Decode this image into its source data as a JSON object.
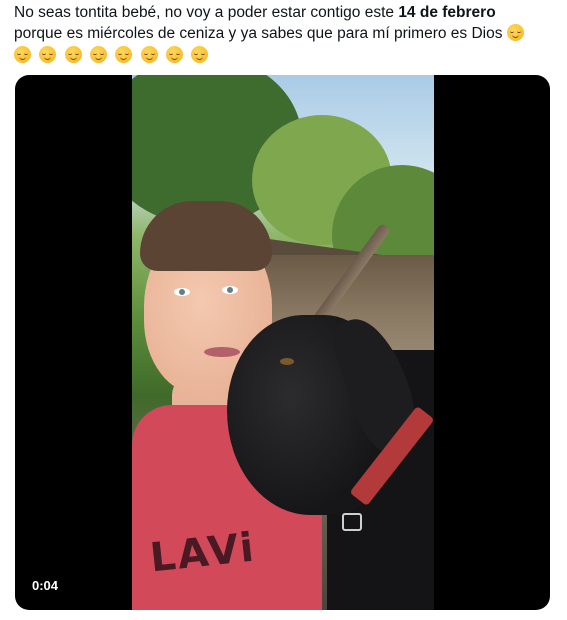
{
  "tweet": {
    "text_part1": "No seas tontita bebé, no voy a poder estar contigo este ",
    "text_bold": "14 de febrero",
    "text_part2": "porque es miércoles de ceniza y ya sabes que para mí primero es Dios",
    "emoji_name": "relieved-face-emoji",
    "emoji_count_line1": 1,
    "emoji_count_line2": 8
  },
  "media": {
    "type": "video",
    "timestamp": "0:04",
    "shirt_text": "LAVi"
  },
  "colors": {
    "background": "#ffffff",
    "text": "#0f1419",
    "media_background": "#000000"
  }
}
